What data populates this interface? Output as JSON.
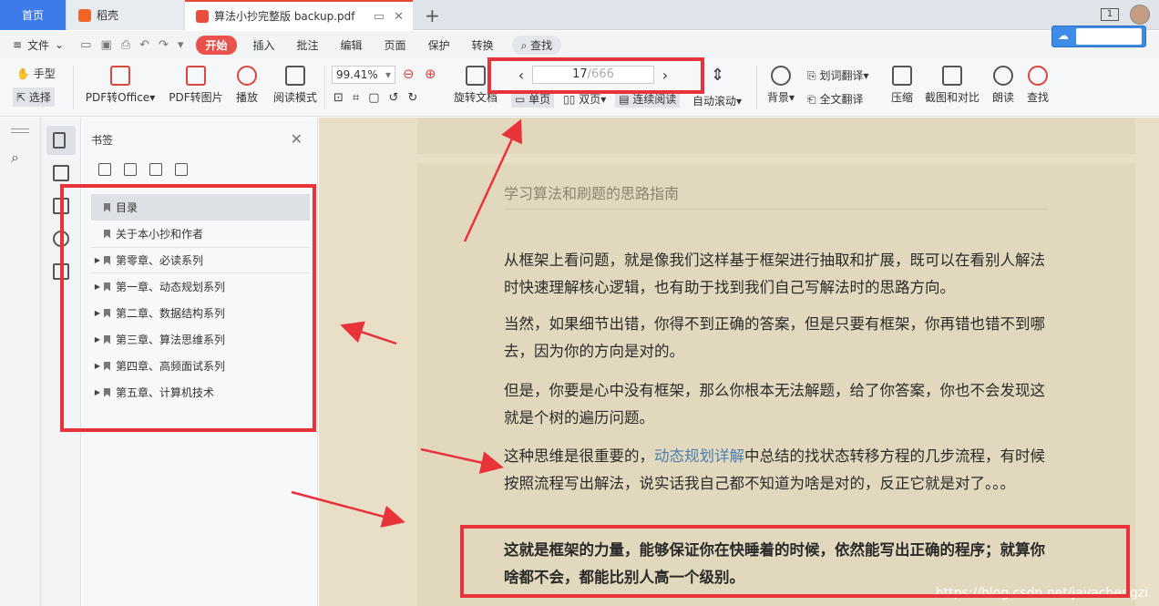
{
  "tabs": {
    "home": "首页",
    "daoke": "稻壳",
    "document": "算法小抄完整版 backup.pdf"
  },
  "topbar": {
    "page_badge": "1"
  },
  "menu": {
    "file": "文件",
    "items": [
      "开始",
      "插入",
      "批注",
      "编辑",
      "页面",
      "保护",
      "转换"
    ],
    "search": "查找"
  },
  "ribbon": {
    "hand": "手型",
    "select": "选择",
    "pdf_to_office": "PDF转Office",
    "pdf_to_image": "PDF转图片",
    "play": "播放",
    "read_mode": "阅读模式",
    "zoom": "99.41%",
    "rotate": "旋转文档",
    "page_current": "17",
    "page_total": "/666",
    "single_page": "单页",
    "double_page": "双页",
    "continuous": "连续阅读",
    "auto_scroll": "自动滚动",
    "background": "背景",
    "word_translate": "划词翻译",
    "full_translate": "全文翻译",
    "compress": "压缩",
    "screenshot_compare": "截图和对比",
    "read_aloud": "朗读",
    "find": "查找"
  },
  "bookmarks": {
    "title": "书签",
    "items": [
      {
        "label": "目录",
        "expandable": false
      },
      {
        "label": "关于本小抄和作者",
        "expandable": false
      },
      {
        "label": "第零章、必读系列",
        "expandable": true
      },
      {
        "label": "第一章、动态规划系列",
        "expandable": true
      },
      {
        "label": "第二章、数据结构系列",
        "expandable": true
      },
      {
        "label": "第三章、算法思维系列",
        "expandable": true
      },
      {
        "label": "第四章、高频面试系列",
        "expandable": true
      },
      {
        "label": "第五章、计算机技术",
        "expandable": true
      }
    ]
  },
  "document": {
    "header": "学习算法和刷题的思路指南",
    "p1": "从框架上看问题，就是像我们这样基于框架进行抽取和扩展，既可以在看别人解法时快速理解核心逻辑，也有助于找到我们自己写解法时的思路方向。",
    "p2": "当然，如果细节出错，你得不到正确的答案，但是只要有框架，你再错也错不到哪去，因为你的方向是对的。",
    "p3": "但是，你要是心中没有框架，那么你根本无法解题，给了你答案，你也不会发现这就是个树的遍历问题。",
    "p4_pre": "这种思维是很重要的，",
    "p4_link": "动态规划详解",
    "p4_post": "中总结的找状态转移方程的几步流程，有时候按照流程写出解法，说实话我自己都不知道为啥是对的，反正它就是对了。。。",
    "p5": "这就是框架的力量，能够保证你在快睡着的时候，依然能写出正确的程序；就算你啥都不会，都能比别人高一个级别。"
  },
  "watermark": "https://blog.csdn.net/javachengzi",
  "colors": {
    "annotation_red": "#e8333a",
    "accent_blue": "#3c7be8",
    "page_bg": "#e2d8bd"
  }
}
